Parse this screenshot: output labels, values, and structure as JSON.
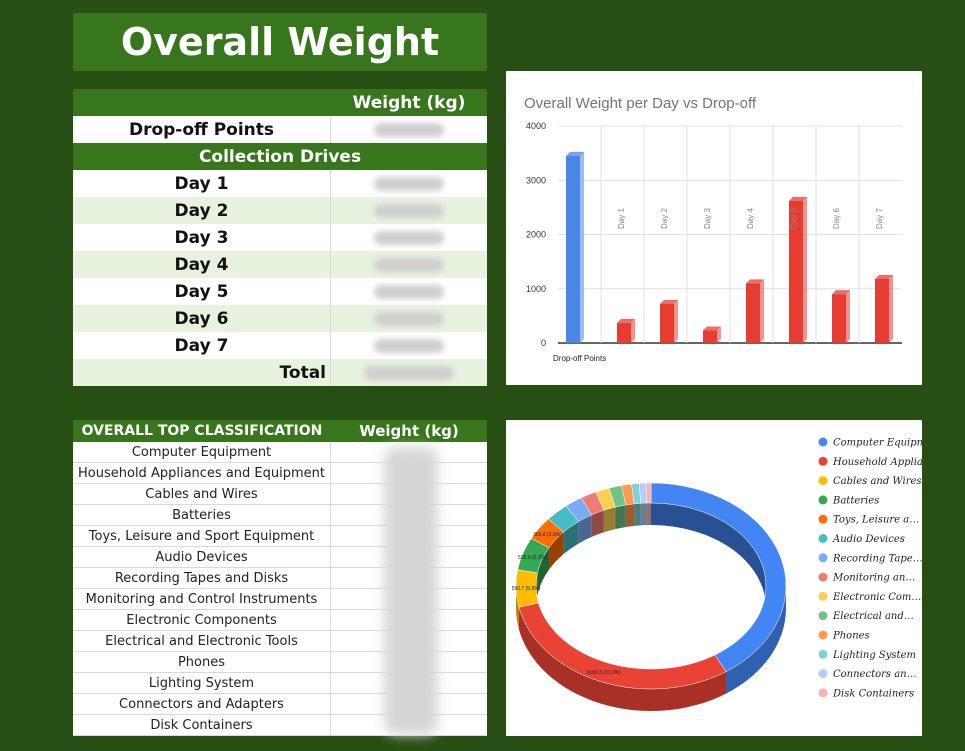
{
  "title": "Overall Weight",
  "top_table": {
    "weight_header": "Weight (kg)",
    "dropoff_label": "Drop-off Points",
    "drives_header": "Collection Drives",
    "days": [
      "Day 1",
      "Day 2",
      "Day 3",
      "Day 4",
      "Day 5",
      "Day 6",
      "Day 7"
    ],
    "total_label": "Total"
  },
  "bottom_table": {
    "header": "OVERALL TOP CLASSIFICATION",
    "weight_header": "Weight (kg)",
    "items": [
      "Computer Equipment",
      "Household Appliances and Equipment",
      "Cables and Wires",
      "Batteries",
      "Toys, Leisure and Sport Equipment",
      "Audio Devices",
      "Recording Tapes and Disks",
      "Monitoring and Control Instruments",
      "Electronic Components",
      "Electrical and Electronic Tools",
      "Phones",
      "Lighting System",
      "Connectors and Adapters",
      "Disk Containers"
    ]
  },
  "chart_data": [
    {
      "type": "bar",
      "title": "Overall Weight per Day vs Drop-off",
      "categories": [
        "Drop-off Points",
        "Day 1",
        "Day 2",
        "Day 3",
        "Day 4",
        "Day 5",
        "Day 6",
        "Day 7"
      ],
      "series": [
        {
          "color": "#4a86e8",
          "values": [
            3450,
            0,
            0,
            0,
            0,
            0,
            0,
            0
          ]
        },
        {
          "color": "#e63c32",
          "values": [
            0,
            370,
            720,
            230,
            1100,
            2620,
            900,
            1180
          ]
        }
      ],
      "bar_labels": [
        "",
        "Day 1",
        "Day 2",
        "Day 3",
        "Day 4",
        "Day 5",
        "Day 6",
        "Day 7"
      ],
      "ylim": [
        0,
        4000
      ],
      "yticks": [
        "4000",
        "3000",
        "2000",
        "1000",
        "0"
      ]
    },
    {
      "type": "pie",
      "labels": [
        "Computer Equipment",
        "Household Appliances and Equipment",
        "Cables and Wires",
        "Batteries",
        "Toys, Leisure and Sport Equipment",
        "Audio Devices",
        "Recording Tapes and Disks",
        "Monitoring and Control Instruments",
        "Electronic Components",
        "Electrical and Electronic Tools",
        "Phones",
        "Lighting System",
        "Connectors and Adapters",
        "Disk Containers"
      ],
      "legend": [
        "Computer Equipment",
        "Household Appliances and…",
        "Cables and Wires",
        "Batteries",
        "Toys, Leisure a…",
        "Audio Devices",
        "Recording Tape…",
        "Monitoring an…",
        "Electronic Com…",
        "Electrical and…",
        "Phones",
        "Lighting System",
        "Connectors an…",
        "Disk Containers"
      ],
      "values": [
        40.5,
        31.0,
        5.8,
        5.1,
        3.6,
        2.9,
        2.2,
        1.9,
        1.7,
        1.5,
        1.2,
        0.9,
        0.8,
        0.6
      ],
      "colors": [
        "#4285f4",
        "#ea4335",
        "#fbbc04",
        "#34a853",
        "#ff6d01",
        "#46bdc6",
        "#7baaf7",
        "#f07b72",
        "#fcd04f",
        "#71c287",
        "#ff994d",
        "#7ed1d7",
        "#b3cefb",
        "#f7b4ae"
      ],
      "slice_labels": [
        "",
        "3183.3 (31.0%)",
        "590.7 (5.8%)",
        "520.9 (5.1%)",
        "365.8 (3.6%)",
        "",
        "",
        "",
        "",
        "",
        "",
        "",
        "",
        ""
      ],
      "legend_position": "right"
    }
  ]
}
